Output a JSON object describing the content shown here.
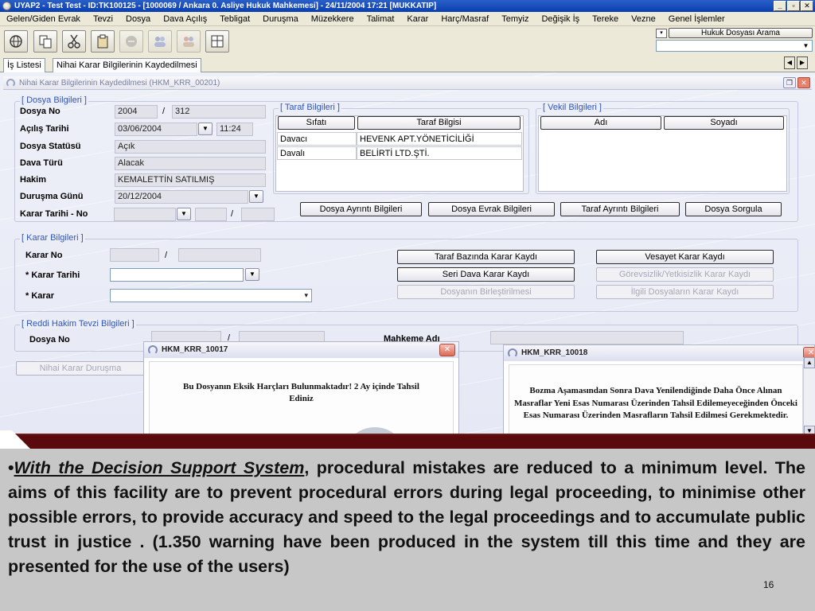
{
  "window": {
    "title": "UYAP2 - Test Test - ID:TK100125 - [1000069 / Ankara 0. Asliye Hukuk Mahkemesi] - 24/11/2004 17:21 [MUKKATIP]",
    "minimize": "_",
    "maximize": "▫",
    "close": "✕"
  },
  "menu": [
    "Gelen/Giden Evrak",
    "Tevzi",
    "Dosya",
    "Dava Açılış",
    "Tebligat",
    "Duruşma",
    "Müzekkere",
    "Talimat",
    "Karar",
    "Harç/Masraf",
    "Temyiz",
    "Değişik İş",
    "Tereke",
    "Vezne",
    "Genel İşlemler"
  ],
  "toolbar": {
    "icons": [
      "globe-icon",
      "copy-icon",
      "cut-icon",
      "paste-icon",
      "stop-icon",
      "users-icon",
      "group-icon",
      "calculator-icon"
    ],
    "search_button": "Hukuk Dosyası Arama",
    "search_select_value": ""
  },
  "tabs": [
    "İş Listesi",
    "Nihai Karar Bilgilerinin Kaydedilmesi"
  ],
  "inner_window": {
    "title": "Nihai Karar Bilgilerinin Kaydedilmesi (HKM_KRR_00201)"
  },
  "dosya": {
    "group_title": "[ Dosya Bilgileri ]",
    "dosya_no_label": "Dosya No",
    "dosya_no_year": "2004",
    "dosya_no_sep": "/",
    "dosya_no_num": "312",
    "acilis_label": "Açılış Tarihi",
    "acilis_date": "03/06/2004",
    "acilis_time": "11:24",
    "statu_label": "Dosya Statüsü",
    "statu": "Açık",
    "dava_turu_label": "Dava Türü",
    "dava_turu": "Alacak",
    "hakim_label": "Hakim",
    "hakim": "KEMALETTİN SATILMIŞ",
    "durusma_label": "Duruşma Günü",
    "durusma": "20/12/2004",
    "karar_tarihi_no_label": "Karar Tarihi - No",
    "karar_tarihi_no_sep": "/"
  },
  "taraf": {
    "group_title": "[ Taraf Bilgileri ]",
    "col_sifati": "Sıfatı",
    "col_bilgisi": "Taraf Bilgisi",
    "rows": [
      {
        "sifat": "Davacı",
        "bilgi": "HEVENK APT.YÖNETİCİLİĞİ"
      },
      {
        "sifat": "Davalı",
        "bilgi": "BELİRTİ LTD.ŞTİ."
      }
    ]
  },
  "vekil": {
    "group_title": "[ Vekil Bilgileri ]",
    "col_adi": "Adı",
    "col_soyadi": "Soyadı"
  },
  "dosya_buttons": [
    "Dosya Ayrıntı Bilgileri",
    "Dosya Evrak Bilgileri",
    "Taraf Ayrıntı Bilgileri",
    "Dosya Sorgula"
  ],
  "karar": {
    "group_title": "[ Karar Bilgileri ]",
    "karar_no_label": "Karar No",
    "karar_no_sep": "/",
    "karar_tarihi_label": "* Karar Tarihi",
    "karar_label": "* Karar",
    "buttons": {
      "taraf_bazinda": "Taraf Bazında Karar Kaydı",
      "vesayet": "Vesayet Karar Kaydı",
      "seri_dava": "Seri Dava Karar Kaydı",
      "gorevsizlik": "Görevsizlik/Yetkisizlik Karar Kaydı",
      "birlestirilmesi": "Dosyanın Birleştirilmesi",
      "ilgili_dosyalar": "İlgili Dosyaların Karar Kaydı"
    }
  },
  "reddi": {
    "group_title": "[ Reddi Hakim Tevzi Bilgileri ]",
    "dosya_no_label": "Dosya No",
    "dosya_no_sep": "/",
    "mahkeme_label": "Mahkeme Adı"
  },
  "nihai_durusma_button": "Nihai Karar Duruşma",
  "dialog1": {
    "title": "HKM_KRR_10017",
    "message": "Bu Dosyanın Eksik Harçları Bulunmaktadır! 2 Ay içinde Tahsil Ediniz"
  },
  "dialog2": {
    "title": "HKM_KRR_10018",
    "message": "Bozma Aşamasından Sonra Dava Yenilendiğinde Daha Önce Alınan Masraflar Yeni Esas Numarası Üzerinden Tahsil Edilemeyeceğinden Önceki Esas Numarası Üzerinden Masrafların Tahsil Edilmesi Gerekmektedir."
  },
  "caption": {
    "bullet": "•",
    "emphasis": "With the Decision Support System",
    "text": ", procedural mistakes are reduced to a minimum level. The aims of this facility are to prevent procedural errors during legal proceeding, to minimise other possible errors, to provide accuracy and speed to the legal proceedings and to accumulate public trust in justice . (1.350 warning have been produced in the system till this time and they are presented for the use of the users)"
  },
  "page_number": "16",
  "colors": {
    "titlebar": "#0a3fb0",
    "group_title": "#3054b8",
    "band": "#5a0a0c",
    "caption_bg": "#c7c7c7"
  }
}
